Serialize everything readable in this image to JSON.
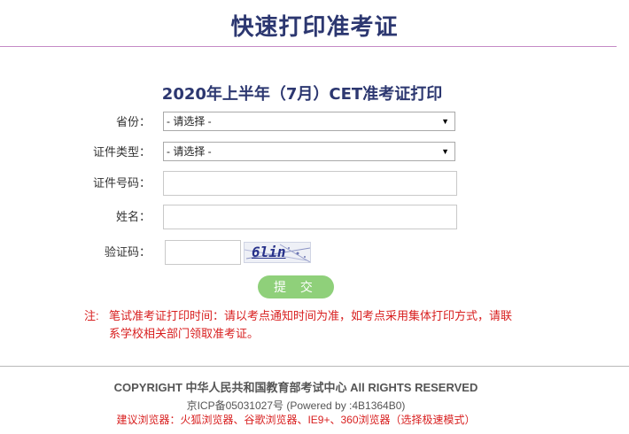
{
  "header": {
    "title": "快速打印准考证"
  },
  "form": {
    "title": "2020年上半年（7月）CET准考证打印",
    "province_label": "省份：",
    "province_value": "- 请选择 -",
    "id_type_label": "证件类型：",
    "id_type_value": "- 请选择 -",
    "id_number_label": "证件号码：",
    "name_label": "姓名：",
    "captcha_label": "验证码：",
    "captcha_text": "6lin",
    "submit_label": "提 交",
    "dropdown_arrow": "▼"
  },
  "note": {
    "prefix": "注:",
    "line1": "笔试准考证打印时间：请以考点通知时间为准，如考点采用集体打印方式，请联",
    "line2": "系学校相关部门领取准考证。"
  },
  "footer": {
    "copyright": "COPYRIGHT 中华人民共和国教育部考试中心 All RIGHTS RESERVED",
    "icp": "京ICP备05031027号 (Powered by :4B1364B0)",
    "browser_tip": "建议浏览器：火狐浏览器、谷歌浏览器、IE9+、360浏览器（选择极速模式）"
  },
  "colors": {
    "title": "#2c3770",
    "accent_rule": "#c58ac6",
    "submit": "#8fd07a",
    "note": "#d81f1f"
  }
}
